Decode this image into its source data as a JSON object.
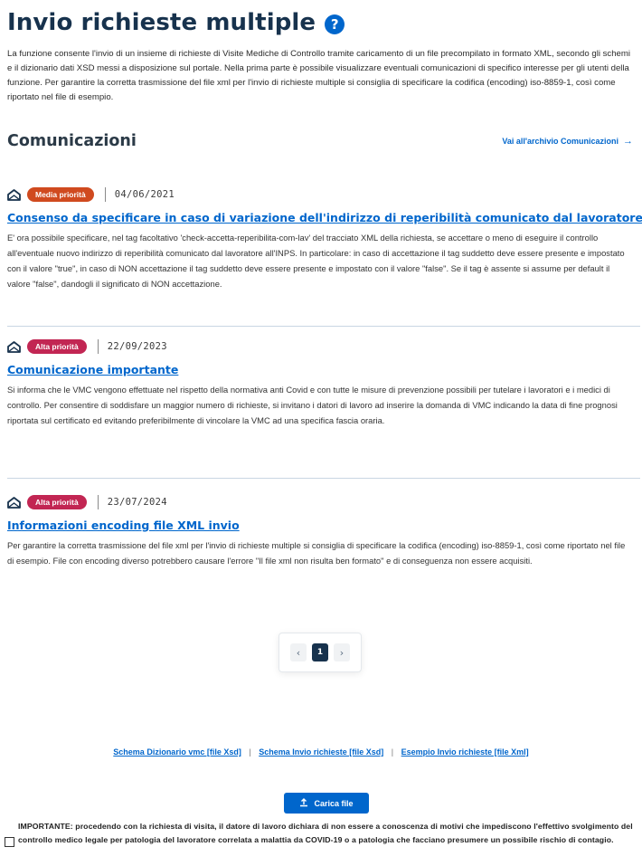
{
  "page": {
    "title": "Invio richieste multiple",
    "help_icon": "?",
    "intro": "La funzione consente l'invio di un insieme di richieste di Visite Mediche di Controllo tramite caricamento di un file precompilato in formato XML, secondo gli schemi e il dizionario dati XSD messi a disposizione sul portale. Nella prima parte è possibile visualizzare eventuali comunicazioni di specifico interesse per gli utenti della funzione. Per garantire la corretta trasmissione del file xml per l'invio di richieste multiple si consiglia di specificare la codifica (encoding) iso-8859-1, così come riportato nel file di esempio."
  },
  "communications": {
    "title": "Comunicazioni",
    "archive_link": "Vai all'archivio Comunicazioni",
    "archive_icon": "arrow-right-icon",
    "items": [
      {
        "priority": "Media priorità",
        "priority_color": "#d04a1f",
        "date": "04/06/2021",
        "title": "Consenso da specificare in caso di variazione dell'indirizzo di reperibilità comunicato dal lavoratore.",
        "body": "E' ora possibile specificare, nel tag facoltativo 'check-accetta-reperibilita-com-lav' del tracciato XML della richiesta, se accettare o meno di eseguire il controllo all'eventuale nuovo indirizzo di reperibilità comunicato dal lavoratore all'INPS. In particolare: in caso di accettazione il tag suddetto deve essere presente e impostato con il valore \"true\", in caso di NON accettazione il tag suddetto deve essere presente e impostato con il valore \"false\". Se il tag è assente si assume per default il valore \"false\", dandogli il significato di NON accettazione."
      },
      {
        "priority": "Alta priorità",
        "priority_color": "#c22653",
        "date": "22/09/2023",
        "title": "Comunicazione importante",
        "body": "Si informa che le VMC vengono effettuate nel rispetto della normativa anti Covid e con tutte le misure di prevenzione possibili per tutelare i lavoratori e i medici di controllo. Per consentire di soddisfare un maggior numero di richieste, si invitano i datori di lavoro ad inserire la domanda di VMC indicando la data di fine prognosi riportata sul certificato ed evitando preferibilmente di vincolare la VMC ad una specifica fascia oraria."
      },
      {
        "priority": "Alta priorità",
        "priority_color": "#c22653",
        "date": "23/07/2024",
        "title": "Informazioni encoding file XML invio",
        "body": "Per garantire la corretta trasmissione del file xml per l'invio di richieste multiple si consiglia di specificare la codifica (encoding) iso-8859-1, così come riportato nel file di esempio. File con encoding diverso potrebbero causare l'errore \"Il file xml non risulta ben formato\" e di conseguenza non essere acquisiti."
      }
    ]
  },
  "pagination": {
    "prev": "‹",
    "current": "1",
    "next": "›"
  },
  "links": {
    "schema_dizionario": "Schema Dizionario vmc [file Xsd]",
    "schema_invio": "Schema Invio richieste [file Xsd]",
    "esempio_invio": "Esempio Invio richieste [file Xml]",
    "separator": "|"
  },
  "upload": {
    "label": "Carica file",
    "icon": "upload-icon"
  },
  "important": {
    "text": "IMPORTANTE: procedendo con la richiesta di visita, il datore di lavoro dichiara di non essere a conoscenza di motivi che impediscono l'effettivo svolgimento del controllo medico legale per patologia del lavoratore correlata a malattia da COVID-19 o a patologia che facciano presumere un possibile rischio di contagio.",
    "checked": false
  }
}
